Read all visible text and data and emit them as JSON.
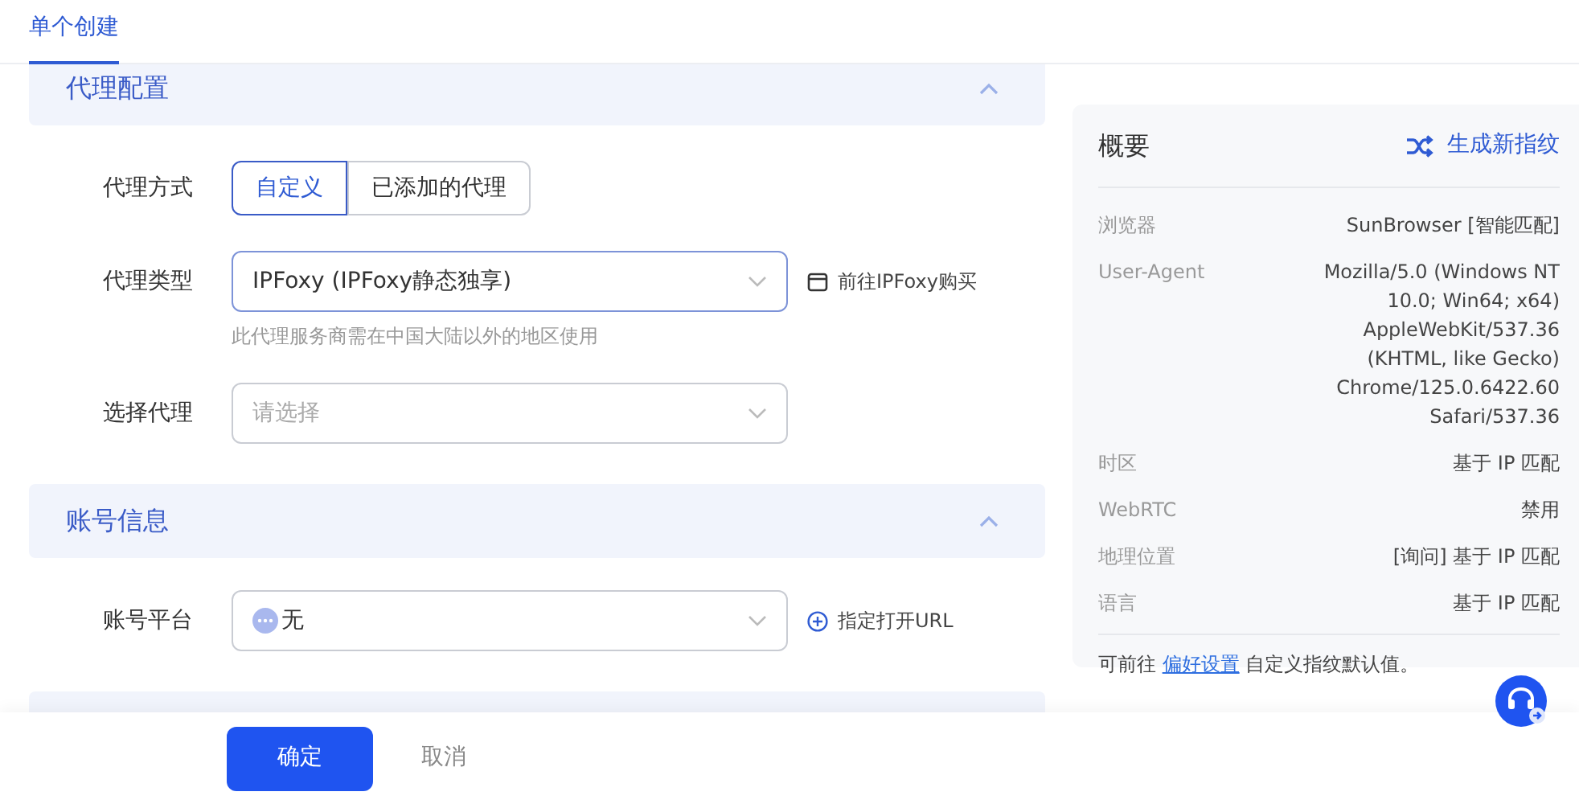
{
  "tabs": [
    {
      "label": "单个创建",
      "selected": true
    }
  ],
  "sections": [
    {
      "title": "代理配置",
      "expanded": true,
      "fields": [
        {
          "kind": "segmented",
          "label": "代理方式",
          "options": [
            {
              "label": "自定义",
              "selected": true
            },
            {
              "label": "已添加的代理",
              "selected": false
            }
          ]
        },
        {
          "kind": "select",
          "label": "代理类型",
          "value": "IPFoxy (IPFoxy静态独享)",
          "hint": "此代理服务商需在中国大陆以外的地区使用",
          "action": {
            "kind": "external",
            "label": "前往IPFoxy购买"
          }
        },
        {
          "kind": "select",
          "label": "选择代理",
          "placeholder": "请选择"
        }
      ]
    },
    {
      "title": "账号信息",
      "expanded": true,
      "fields": [
        {
          "kind": "platform-select",
          "label": "账号平台",
          "value": "无",
          "action": {
            "kind": "add",
            "label": "指定打开URL"
          }
        }
      ]
    }
  ],
  "summary": {
    "title": "概要",
    "action": "生成新指纹",
    "rows": [
      {
        "label": "浏览器",
        "value": "SunBrowser [智能匹配]"
      },
      {
        "label": "User-Agent",
        "value": "Mozilla/5.0 (Windows NT\n10.0; Win64; x64)\nAppleWebKit/537.36\n(KHTML, like Gecko)\nChrome/125.0.6422.60\nSafari/537.36"
      },
      {
        "label": "时区",
        "value": "基于 IP 匹配"
      },
      {
        "label": "WebRTC",
        "value": "禁用"
      },
      {
        "label": "地理位置",
        "value": "[询问] 基于 IP 匹配"
      },
      {
        "label": "语言",
        "value": "基于 IP 匹配"
      }
    ],
    "note": {
      "before": "可前往",
      "link": "偏好设置",
      "after": "自定义指纹默认值。"
    }
  },
  "footer": {
    "confirm": "确定",
    "cancel": "取消"
  }
}
